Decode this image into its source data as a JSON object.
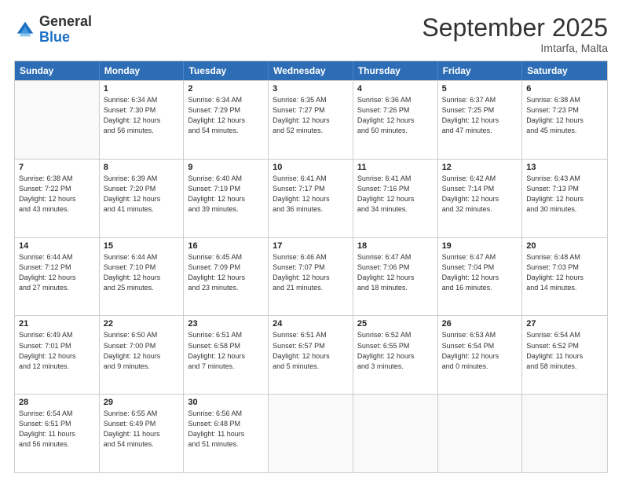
{
  "logo": {
    "general": "General",
    "blue": "Blue"
  },
  "header": {
    "month": "September 2025",
    "location": "Imtarfa, Malta"
  },
  "days": [
    "Sunday",
    "Monday",
    "Tuesday",
    "Wednesday",
    "Thursday",
    "Friday",
    "Saturday"
  ],
  "weeks": [
    [
      {
        "day": "",
        "info": ""
      },
      {
        "day": "1",
        "info": "Sunrise: 6:34 AM\nSunset: 7:30 PM\nDaylight: 12 hours\nand 56 minutes."
      },
      {
        "day": "2",
        "info": "Sunrise: 6:34 AM\nSunset: 7:29 PM\nDaylight: 12 hours\nand 54 minutes."
      },
      {
        "day": "3",
        "info": "Sunrise: 6:35 AM\nSunset: 7:27 PM\nDaylight: 12 hours\nand 52 minutes."
      },
      {
        "day": "4",
        "info": "Sunrise: 6:36 AM\nSunset: 7:26 PM\nDaylight: 12 hours\nand 50 minutes."
      },
      {
        "day": "5",
        "info": "Sunrise: 6:37 AM\nSunset: 7:25 PM\nDaylight: 12 hours\nand 47 minutes."
      },
      {
        "day": "6",
        "info": "Sunrise: 6:38 AM\nSunset: 7:23 PM\nDaylight: 12 hours\nand 45 minutes."
      }
    ],
    [
      {
        "day": "7",
        "info": "Sunrise: 6:38 AM\nSunset: 7:22 PM\nDaylight: 12 hours\nand 43 minutes."
      },
      {
        "day": "8",
        "info": "Sunrise: 6:39 AM\nSunset: 7:20 PM\nDaylight: 12 hours\nand 41 minutes."
      },
      {
        "day": "9",
        "info": "Sunrise: 6:40 AM\nSunset: 7:19 PM\nDaylight: 12 hours\nand 39 minutes."
      },
      {
        "day": "10",
        "info": "Sunrise: 6:41 AM\nSunset: 7:17 PM\nDaylight: 12 hours\nand 36 minutes."
      },
      {
        "day": "11",
        "info": "Sunrise: 6:41 AM\nSunset: 7:16 PM\nDaylight: 12 hours\nand 34 minutes."
      },
      {
        "day": "12",
        "info": "Sunrise: 6:42 AM\nSunset: 7:14 PM\nDaylight: 12 hours\nand 32 minutes."
      },
      {
        "day": "13",
        "info": "Sunrise: 6:43 AM\nSunset: 7:13 PM\nDaylight: 12 hours\nand 30 minutes."
      }
    ],
    [
      {
        "day": "14",
        "info": "Sunrise: 6:44 AM\nSunset: 7:12 PM\nDaylight: 12 hours\nand 27 minutes."
      },
      {
        "day": "15",
        "info": "Sunrise: 6:44 AM\nSunset: 7:10 PM\nDaylight: 12 hours\nand 25 minutes."
      },
      {
        "day": "16",
        "info": "Sunrise: 6:45 AM\nSunset: 7:09 PM\nDaylight: 12 hours\nand 23 minutes."
      },
      {
        "day": "17",
        "info": "Sunrise: 6:46 AM\nSunset: 7:07 PM\nDaylight: 12 hours\nand 21 minutes."
      },
      {
        "day": "18",
        "info": "Sunrise: 6:47 AM\nSunset: 7:06 PM\nDaylight: 12 hours\nand 18 minutes."
      },
      {
        "day": "19",
        "info": "Sunrise: 6:47 AM\nSunset: 7:04 PM\nDaylight: 12 hours\nand 16 minutes."
      },
      {
        "day": "20",
        "info": "Sunrise: 6:48 AM\nSunset: 7:03 PM\nDaylight: 12 hours\nand 14 minutes."
      }
    ],
    [
      {
        "day": "21",
        "info": "Sunrise: 6:49 AM\nSunset: 7:01 PM\nDaylight: 12 hours\nand 12 minutes."
      },
      {
        "day": "22",
        "info": "Sunrise: 6:50 AM\nSunset: 7:00 PM\nDaylight: 12 hours\nand 9 minutes."
      },
      {
        "day": "23",
        "info": "Sunrise: 6:51 AM\nSunset: 6:58 PM\nDaylight: 12 hours\nand 7 minutes."
      },
      {
        "day": "24",
        "info": "Sunrise: 6:51 AM\nSunset: 6:57 PM\nDaylight: 12 hours\nand 5 minutes."
      },
      {
        "day": "25",
        "info": "Sunrise: 6:52 AM\nSunset: 6:55 PM\nDaylight: 12 hours\nand 3 minutes."
      },
      {
        "day": "26",
        "info": "Sunrise: 6:53 AM\nSunset: 6:54 PM\nDaylight: 12 hours\nand 0 minutes."
      },
      {
        "day": "27",
        "info": "Sunrise: 6:54 AM\nSunset: 6:52 PM\nDaylight: 11 hours\nand 58 minutes."
      }
    ],
    [
      {
        "day": "28",
        "info": "Sunrise: 6:54 AM\nSunset: 6:51 PM\nDaylight: 11 hours\nand 56 minutes."
      },
      {
        "day": "29",
        "info": "Sunrise: 6:55 AM\nSunset: 6:49 PM\nDaylight: 11 hours\nand 54 minutes."
      },
      {
        "day": "30",
        "info": "Sunrise: 6:56 AM\nSunset: 6:48 PM\nDaylight: 11 hours\nand 51 minutes."
      },
      {
        "day": "",
        "info": ""
      },
      {
        "day": "",
        "info": ""
      },
      {
        "day": "",
        "info": ""
      },
      {
        "day": "",
        "info": ""
      }
    ]
  ]
}
